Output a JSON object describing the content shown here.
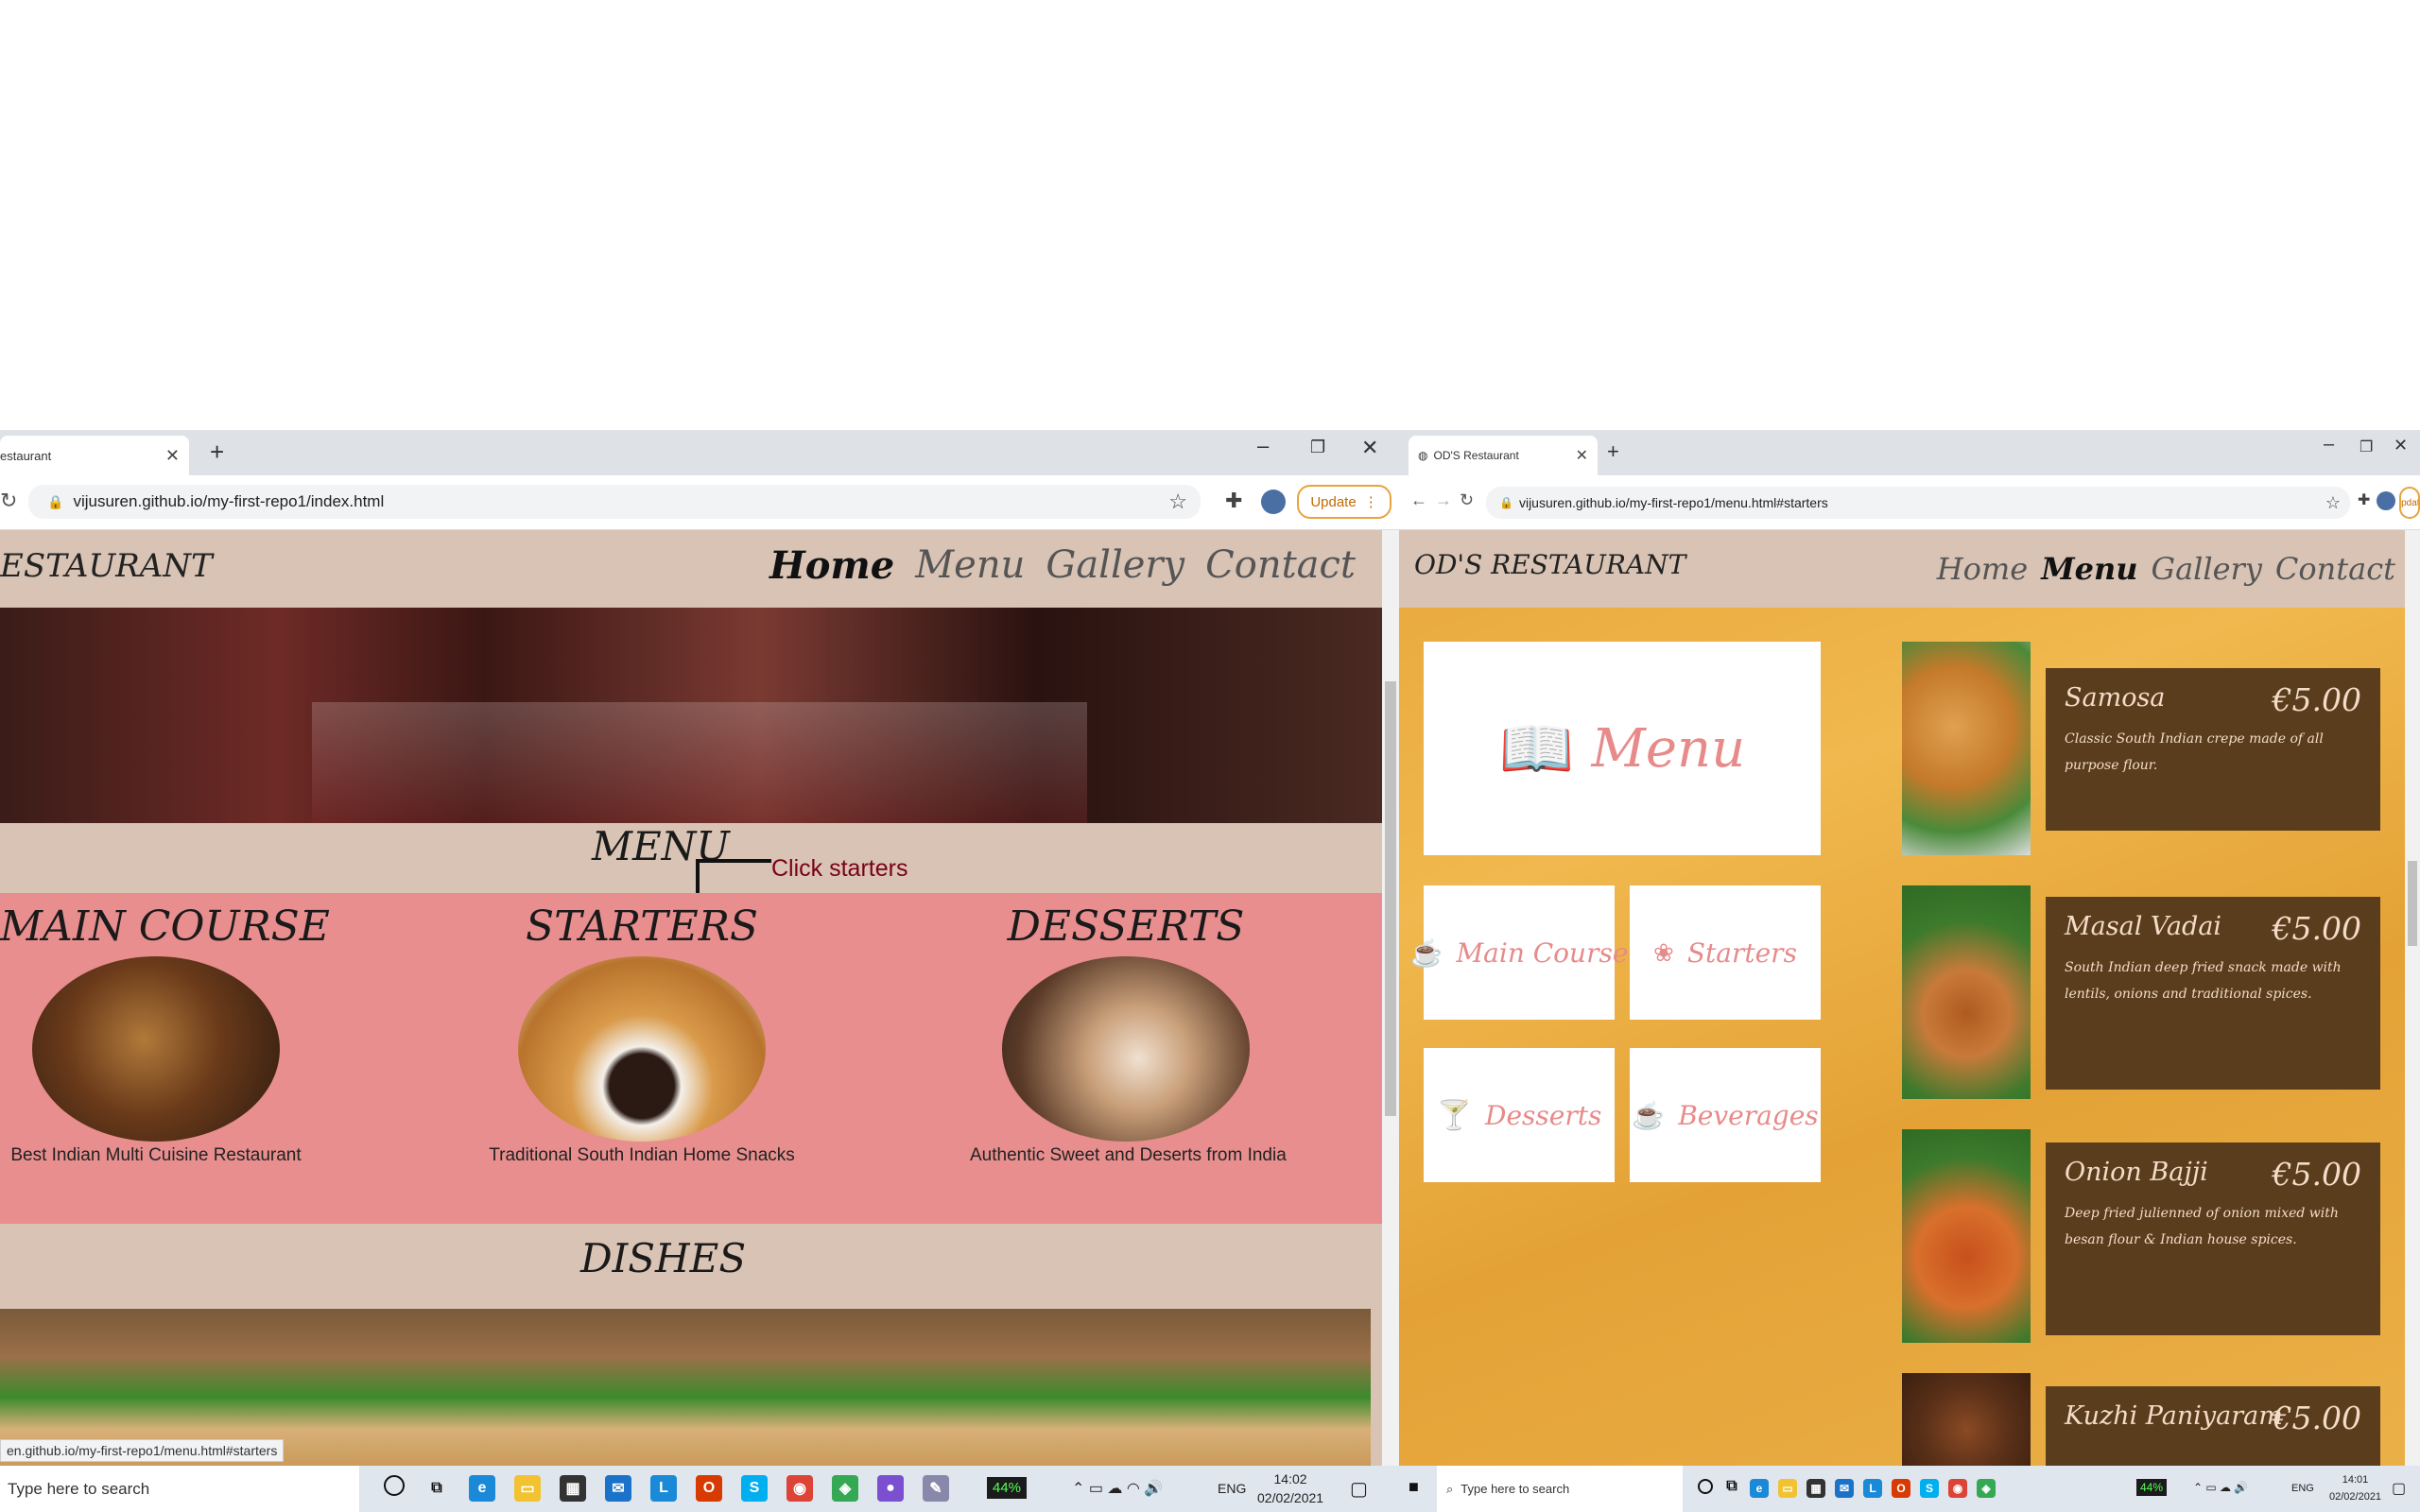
{
  "left": {
    "tab_title": "estaurant",
    "url": "vijusuren.github.io/my-first-repo1/index.html",
    "update_label": "Update",
    "brand": "ESTAURANT",
    "nav": [
      "Home",
      "Menu",
      "Gallery",
      "Contact"
    ],
    "menu_heading": "MENU",
    "callout": "Click starters",
    "categories": [
      {
        "title": "MAIN COURSE",
        "caption": "Best Indian Multi Cuisine Restaurant"
      },
      {
        "title": "STARTERS",
        "caption": "Traditional South Indian Home Snacks"
      },
      {
        "title": "DESSERTS",
        "caption": "Authentic Sweet and Deserts from India"
      }
    ],
    "dishes_heading": "DISHES",
    "status_url": "en.github.io/my-first-repo1/menu.html#starters",
    "taskbar": {
      "search": "Type here to search",
      "battery": "44%",
      "lang": "ENG",
      "time": "14:02",
      "date": "02/02/2021"
    }
  },
  "right": {
    "tab_title": "OD'S Restaurant",
    "url": "vijusuren.github.io/my-first-repo1/menu.html#starters",
    "update_label": "Update",
    "brand": "OD'S RESTAURANT",
    "nav": [
      "Home",
      "Menu",
      "Gallery",
      "Contact"
    ],
    "menu_card": "Menu",
    "menu_cards": [
      "Main Course",
      "Starters",
      "Desserts",
      "Beverages"
    ],
    "dishes": [
      {
        "name": "Samosa",
        "price": "€5.00",
        "desc": "Classic South Indian crepe made of all purpose flour."
      },
      {
        "name": "Masal Vadai",
        "price": "€5.00",
        "desc": "South Indian deep fried snack made with lentils, onions and traditional spices."
      },
      {
        "name": "Onion Bajji",
        "price": "€5.00",
        "desc": "Deep fried julienned of onion mixed with besan flour & Indian house spices."
      },
      {
        "name": "Kuzhi Paniyaram",
        "price": "€5.00",
        "desc": ""
      }
    ],
    "taskbar": {
      "search": "Type here to search",
      "battery": "44%",
      "lang": "ENG",
      "time": "14:01",
      "date": "02/02/2021"
    }
  }
}
